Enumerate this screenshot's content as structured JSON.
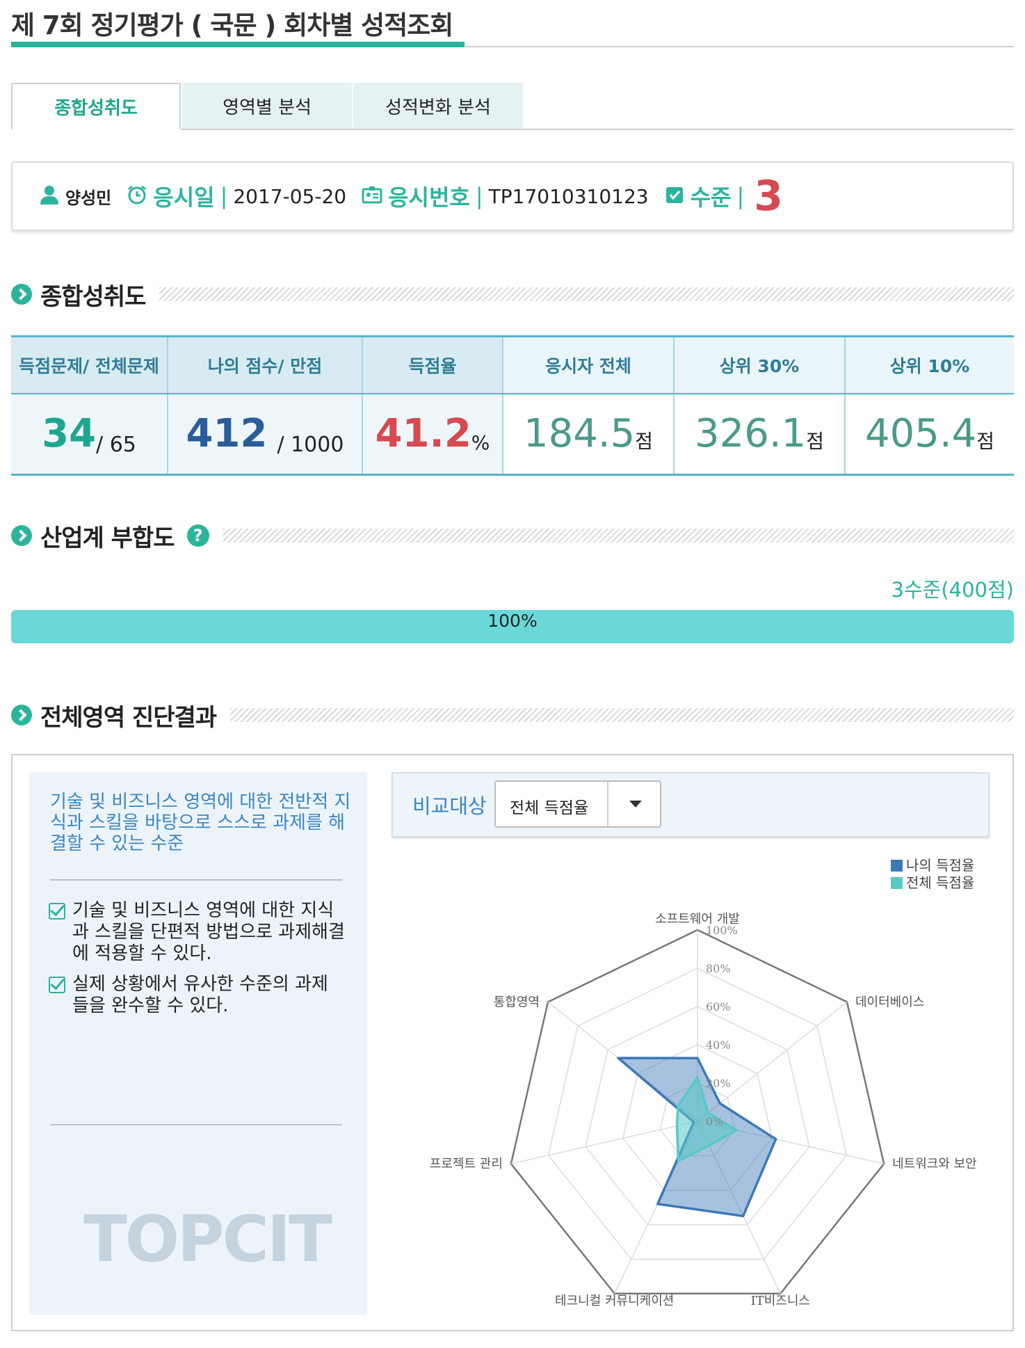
{
  "page": {
    "title": "제 7회 정기평가 ( 국문 ) 회차별 성적조회"
  },
  "tabs": [
    {
      "label": "종합성취도",
      "active": true
    },
    {
      "label": "영역별 분석",
      "active": false
    },
    {
      "label": "성적변화 분석",
      "active": false
    }
  ],
  "info": {
    "user_name": "양성민",
    "exam_date_label": "응시일",
    "exam_date": "2017-05-20",
    "exam_no_label": "응시번호",
    "exam_no": "TP17010310123",
    "level_label": "수준",
    "separator": "|",
    "level": "3"
  },
  "sections": {
    "overall": "종합성취도",
    "industry": "산업계 부합도",
    "industry_help": "?",
    "diagnosis": "전체영역 진단결과"
  },
  "score_table": {
    "headers": [
      "득점문제/ 전체문제",
      "나의 점수/ 만점",
      "득점율",
      "응시자 전체",
      "상위 30%",
      "상위 10%"
    ],
    "correct": "34",
    "total": "/ 65",
    "my_score": "412",
    "max_score": "/ 1000",
    "rate": "41.2",
    "rate_unit": "%",
    "all_avg": "184.5",
    "top30": "326.1",
    "top10": "405.4",
    "point_unit": "점"
  },
  "industry": {
    "level_text": "3수준(400점)",
    "progress_label": "100%",
    "progress_percent": 100
  },
  "diagnosis": {
    "description": "기술 및 비즈니스 영역에 대한 전반적 지식과 스킬을 바탕으로 스스로 과제를 해결할 수 있는 수준",
    "checks": [
      "기술 및 비즈니스 영역에 대한 지식과 스킬을 단편적 방법으로 과제해결에 적용할 수 있다.",
      "실제 상황에서 유사한 수준의 과제 들을 완수할 수 있다."
    ],
    "watermark": "TOPCIT",
    "compare_label": "비교대상",
    "compare_value": "전체 득점율"
  },
  "colors": {
    "accent": "#2bb49c",
    "level_red": "#d64a50",
    "mine": "#3b78b8",
    "all": "#57c9c6"
  },
  "chart_data": {
    "type": "radar",
    "axes": [
      "소프트웨어 개발",
      "데이터베이스",
      "네트워크와 보안",
      "IT비즈니스",
      "테크니컬 커뮤니케이션",
      "프로젝트 관리",
      "통합영역"
    ],
    "ticks": [
      "0%",
      "20%",
      "40%",
      "60%",
      "80%",
      "100%"
    ],
    "range": [
      0,
      100
    ],
    "legend_position": "top-right",
    "series": [
      {
        "name": "나의 득점율",
        "values": [
          33,
          15,
          42,
          55,
          48,
          2,
          53
        ]
      },
      {
        "name": "전체 득점율",
        "values": [
          23,
          7,
          21,
          14,
          23,
          11,
          13
        ]
      }
    ]
  }
}
